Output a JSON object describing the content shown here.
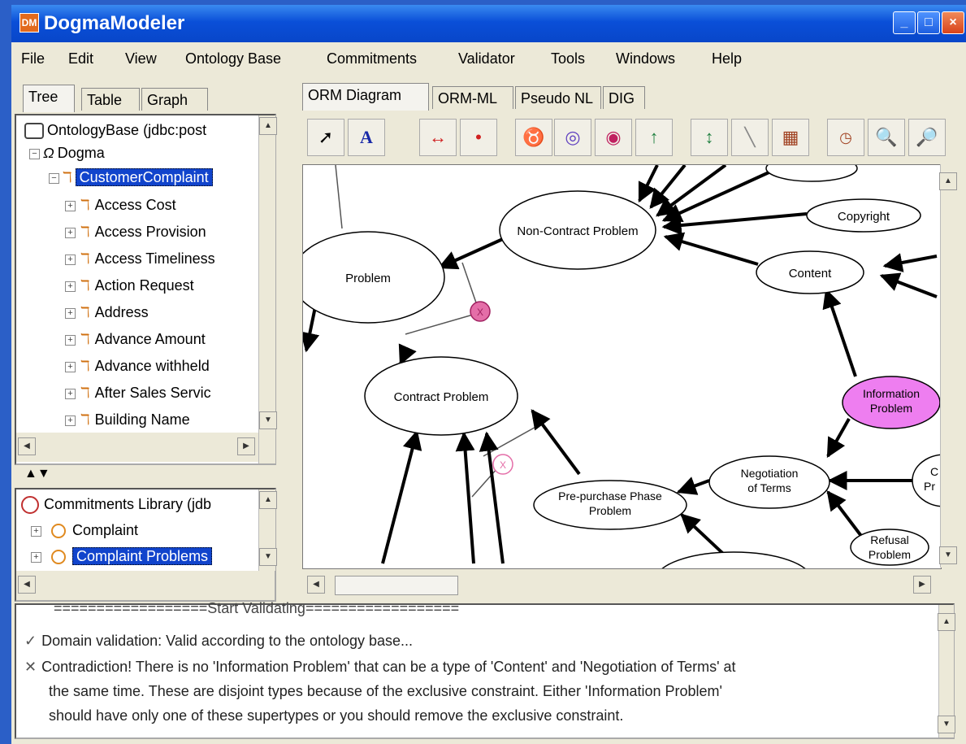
{
  "window": {
    "title": "DogmaModeler",
    "icon": "DM"
  },
  "menu": [
    "File",
    "Edit",
    "View",
    "Ontology Base",
    "Commitments",
    "Validator",
    "Tools",
    "Windows",
    "Help"
  ],
  "left_tabs": [
    "Tree",
    "Table",
    "Graph"
  ],
  "tree": {
    "root": "OntologyBase (jdbc:post",
    "child": "Dogma",
    "selected": "CustomerComplaint",
    "items": [
      "Access Cost",
      "Access Provision",
      "Access Timeliness",
      "Action Request",
      "Address",
      "Advance Amount",
      "Advance withheld",
      "After Sales Servic",
      "Building Name"
    ]
  },
  "commitments": {
    "root": "Commitments Library (jdb",
    "items": [
      "Complaint",
      "Complaint Problems"
    ]
  },
  "right_tabs": [
    "ORM Diagram",
    "ORM-ML",
    "Pseudo NL",
    "DIG"
  ],
  "toolbar_icons": [
    "pointer-icon",
    "text-icon",
    "role-icon",
    "dot-icon",
    "uniqueness-icon",
    "exclusion-icon",
    "mandatory-icon",
    "subtype-icon",
    "arrow-both-icon",
    "line-icon",
    "table-icon",
    "value-icon",
    "zoom-in-icon",
    "zoom-out-icon"
  ],
  "diagram": {
    "nodes": {
      "problem": "Problem",
      "non_contract": "Non-Contract Problem",
      "copyright": "Copyright",
      "content": "Content",
      "contract": "Contract Problem",
      "info_line1": "Information",
      "info_line2": "Problem",
      "neg_line1": "Negotiation",
      "neg_line2": "of Terms",
      "pre_line1": "Pre-purchase Phase",
      "pre_line2": "Problem",
      "refusal_line1": "Refusal",
      "refusal_line2": "Problem",
      "partial1": "C",
      "partial2": "Pr"
    },
    "constraint_symbol": "X",
    "colors": {
      "highlight": "#ee7ef0",
      "constraint": "#e46ea8"
    }
  },
  "console": {
    "header": "==================Start Validating==================",
    "ok": "Domain validation: Valid according to the ontology base...",
    "error1": "Contradiction! There is no 'Information Problem' that can be a type of 'Content' and 'Negotiation of Terms' at",
    "error2": "the same time. These are disjoint types because of the exclusive constraint. Either  'Information Problem'",
    "error3": "should have only one of these supertypes or you should remove the exclusive constraint.",
    "ok_mark": "✓",
    "err_mark": "✕"
  },
  "splitter_arrows": "▲▼"
}
